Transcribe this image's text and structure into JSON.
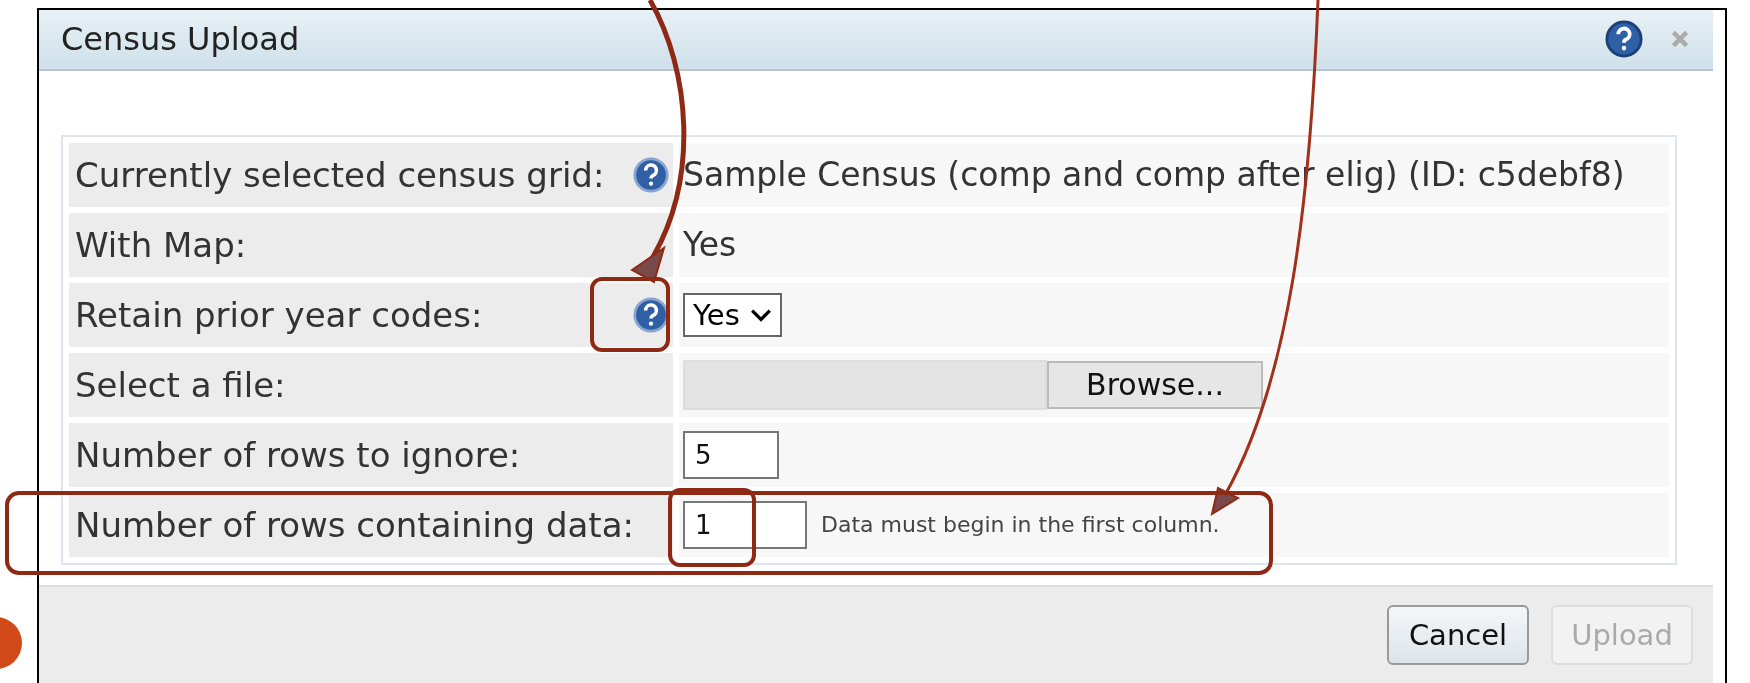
{
  "dialog": {
    "title": "Census Upload"
  },
  "form": {
    "rows": [
      {
        "kind": "text",
        "label": "Currently selected census grid:",
        "help": true,
        "value": "Sample Census (comp and comp after elig) (ID: c5debf8)"
      },
      {
        "kind": "text",
        "label": "With Map:",
        "help": false,
        "value": "Yes"
      },
      {
        "kind": "select",
        "label": "Retain prior year codes:",
        "help": true,
        "value": "Yes"
      },
      {
        "kind": "file",
        "label": "Select a file:",
        "help": false,
        "button": "Browse..."
      },
      {
        "kind": "input",
        "label": "Number of rows to ignore:",
        "help": false,
        "value": "5"
      },
      {
        "kind": "input",
        "label": "Number of rows containing data:",
        "help": false,
        "value": "1",
        "hint": "Data must begin in the first column."
      }
    ]
  },
  "buttons": [
    {
      "label": "Cancel",
      "disabled": false
    },
    {
      "label": "Upload",
      "disabled": true
    }
  ]
}
